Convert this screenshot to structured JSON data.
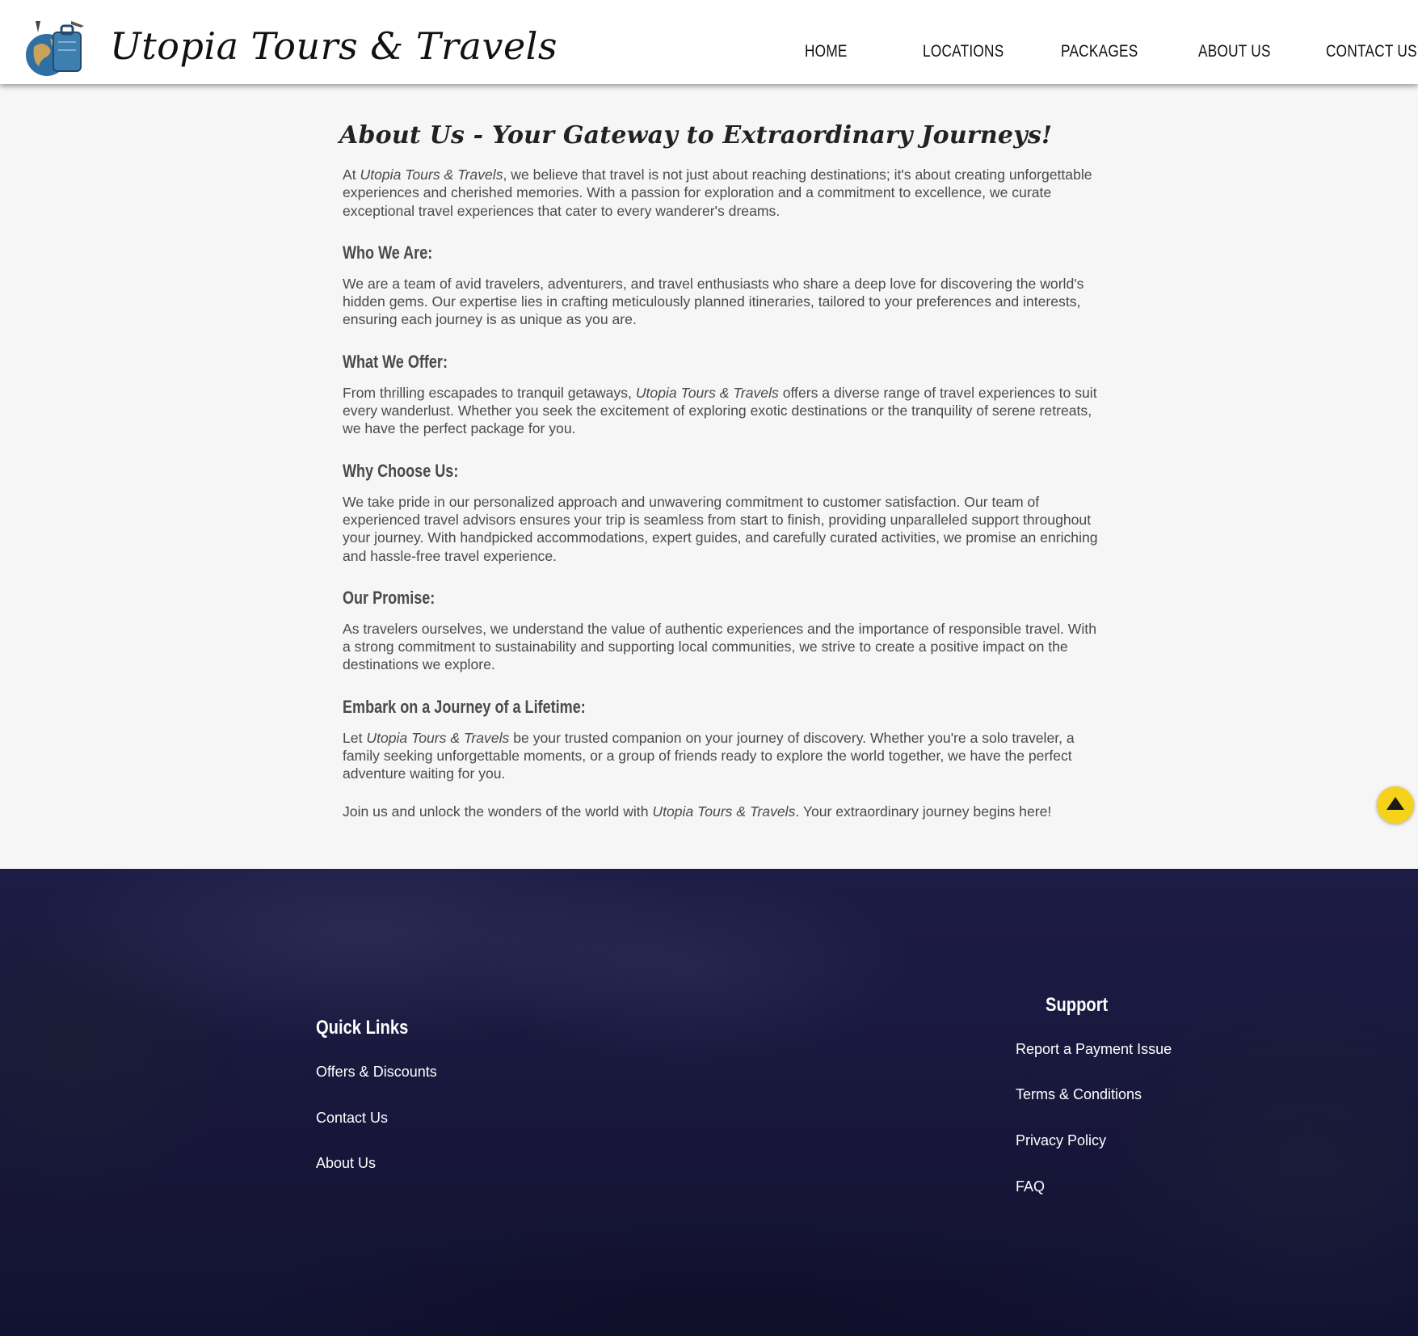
{
  "header": {
    "brand": "Utopia Tours & Travels",
    "nav": [
      "HOME",
      "LOCATIONS",
      "PACKAGES",
      "ABOUT US",
      "CONTACT US"
    ]
  },
  "main": {
    "title": "About Us - Your Gateway to Extraordinary Journeys!",
    "intro": {
      "pre": "At ",
      "brand": "Utopia Tours & Travels",
      "post": ", we believe that travel is not just about reaching destinations; it's about creating unforgettable experiences and cherished memories. With a passion for exploration and a commitment to excellence, we curate exceptional travel experiences that cater to every wanderer's dreams."
    },
    "who": {
      "heading": "Who We Are:",
      "text": "We are a team of avid travelers, adventurers, and travel enthusiasts who share a deep love for discovering the world's hidden gems. Our expertise lies in crafting meticulously planned itineraries, tailored to your preferences and interests, ensuring each journey is as unique as you are."
    },
    "offer": {
      "heading": "What We Offer:",
      "pre": "From thrilling escapades to tranquil getaways, ",
      "brand": "Utopia Tours & Travels",
      "post": " offers a diverse range of travel experiences to suit every wanderlust. Whether you seek the excitement of exploring exotic destinations or the tranquility of serene retreats, we have the perfect package for you."
    },
    "why": {
      "heading": "Why Choose Us:",
      "text": "We take pride in our personalized approach and unwavering commitment to customer satisfaction. Our team of experienced travel advisors ensures your trip is seamless from start to finish, providing unparalleled support throughout your journey. With handpicked accommodations, expert guides, and carefully curated activities, we promise an enriching and hassle-free travel experience."
    },
    "promise": {
      "heading": "Our Promise:",
      "text": "As travelers ourselves, we understand the value of authentic experiences and the importance of responsible travel. With a strong commitment to sustainability and supporting local communities, we strive to create a positive impact on the destinations we explore."
    },
    "embark": {
      "heading": "Embark on a Journey of a Lifetime:",
      "pre": "Let ",
      "brand": "Utopia Tours & Travels",
      "post": " be your trusted companion on your journey of discovery. Whether you're a solo traveler, a family seeking unforgettable moments, or a group of friends ready to explore the world together, we have the perfect adventure waiting for you."
    },
    "join": {
      "pre": "Join us and unlock the wonders of the world with ",
      "brand": "Utopia Tours & Travels",
      "post": ". Your extraordinary journey begins here!"
    }
  },
  "back_to_top": {
    "icon": "triangle-up-icon",
    "color": "#f6d21a"
  },
  "footer": {
    "quick_links": {
      "heading": "Quick Links",
      "links": [
        "Offers & Discounts",
        "Contact Us",
        "About Us"
      ]
    },
    "support": {
      "heading": "Support",
      "links": [
        "Report a Payment Issue",
        "Terms & Conditions",
        "Privacy Policy",
        "FAQ"
      ]
    }
  }
}
